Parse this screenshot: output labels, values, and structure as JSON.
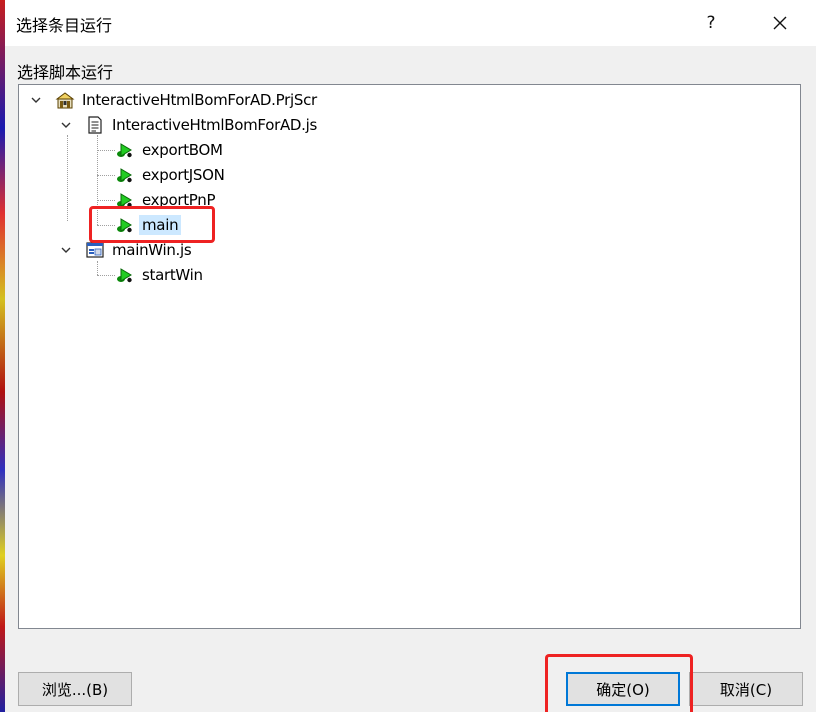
{
  "dialog": {
    "title": "选择条目运行",
    "help_label": "?",
    "close_label": "✕"
  },
  "group": {
    "label": "选择脚本运行"
  },
  "tree": {
    "project": "InteractiveHtmlBomForAD.PrjScr",
    "files": [
      {
        "name": "InteractiveHtmlBomForAD.js",
        "procedures": [
          "exportBOM",
          "exportJSON",
          "exportPnP",
          "main"
        ]
      },
      {
        "name": "mainWin.js",
        "procedures": [
          "startWin"
        ]
      }
    ],
    "selected": "main"
  },
  "buttons": {
    "browse": "浏览...(B)",
    "ok": "确定(O)",
    "cancel": "取消(C)"
  },
  "colors": {
    "selection": "#cce8ff",
    "highlight": "#ee2222",
    "default_button_border": "#0078d7"
  },
  "icons": {
    "project": "project-icon",
    "document": "document-icon",
    "form": "form-icon",
    "procedure": "procedure-icon"
  }
}
